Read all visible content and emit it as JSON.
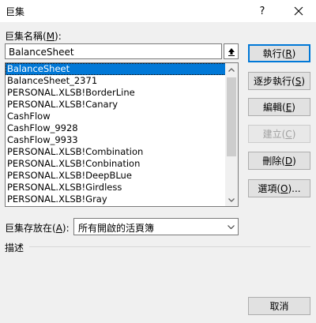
{
  "window": {
    "title": "巨集",
    "help": "?"
  },
  "macro_name": {
    "label_prefix": "巨集名稱(",
    "label_key": "M",
    "label_suffix": "):",
    "value": "BalanceSheet"
  },
  "macro_list": {
    "items": [
      "BalanceSheet",
      "BalanceSheet_2371",
      "PERSONAL.XLSB!BorderLine",
      "PERSONAL.XLSB!Canary",
      "CashFlow",
      "CashFlow_9928",
      "CashFlow_9933",
      "PERSONAL.XLSB!Combination",
      "PERSONAL.XLSB!Conbination",
      "PERSONAL.XLSB!DeepBLue",
      "PERSONAL.XLSB!Girdless",
      "PERSONAL.XLSB!Gray"
    ],
    "selected_index": 0
  },
  "buttons": {
    "run": {
      "prefix": "執行(",
      "key": "R",
      "suffix": ")"
    },
    "step_into": {
      "prefix": "逐步執行(",
      "key": "S",
      "suffix": ")"
    },
    "edit": {
      "prefix": "編輯(",
      "key": "E",
      "suffix": ")"
    },
    "create": {
      "prefix": "建立(",
      "key": "C",
      "suffix": ")"
    },
    "delete": {
      "prefix": "刪除(",
      "key": "D",
      "suffix": ")"
    },
    "options": {
      "prefix": "選項(",
      "key": "O",
      "suffix": ")..."
    },
    "cancel": "取消"
  },
  "macros_in": {
    "label_prefix": "巨集存放在(",
    "label_key": "A",
    "label_suffix": "):",
    "value": "所有開啟的活頁簿"
  },
  "description": {
    "label": "描述"
  },
  "colors": {
    "selection": "#0078d7",
    "default_button_border": "#0078d7"
  }
}
